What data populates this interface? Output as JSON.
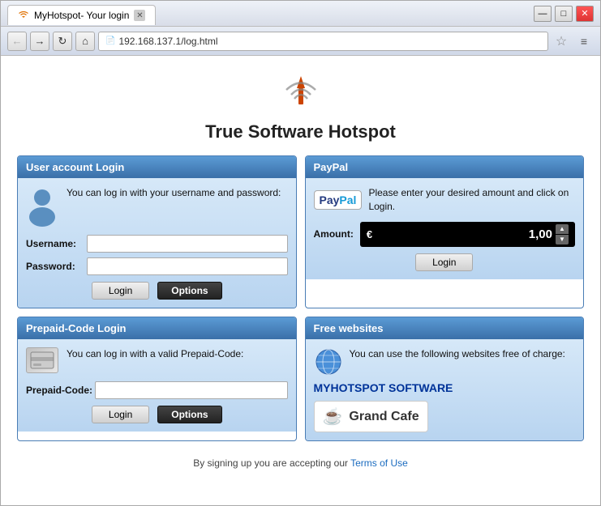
{
  "window": {
    "title": "MyHotspot- Your login",
    "url": "192.168.137.1/log.html"
  },
  "nav": {
    "back_label": "←",
    "forward_label": "→",
    "refresh_label": "↻",
    "home_label": "⌂",
    "menu_label": "≡"
  },
  "page": {
    "title": "True Software Hotspot"
  },
  "user_account": {
    "section_title": "User account Login",
    "description": "You can log in with  your username and password:",
    "username_label": "Username:",
    "password_label": "Password:",
    "login_btn": "Login",
    "options_btn": "Options"
  },
  "paypal": {
    "section_title": "PayPal",
    "description": "Please enter your desired amount and click on Login.",
    "amount_label": "Amount:",
    "currency_symbol": "€",
    "amount_value": "1,00",
    "login_btn": "Login"
  },
  "prepaid": {
    "section_title": "Prepaid-Code Login",
    "description": "You can log in with a valid Prepaid-Code:",
    "code_label": "Prepaid-Code:",
    "login_btn": "Login",
    "options_btn": "Options"
  },
  "free_websites": {
    "section_title": "Free websites",
    "description": "You can use the  following websites  free of charge:",
    "software_label": "MYHOTSPOT SOFTWARE",
    "cafe_name": "Grand Cafe"
  },
  "footer": {
    "text": "By signing up you are accepting our ",
    "link_text": "Terms of Use"
  }
}
